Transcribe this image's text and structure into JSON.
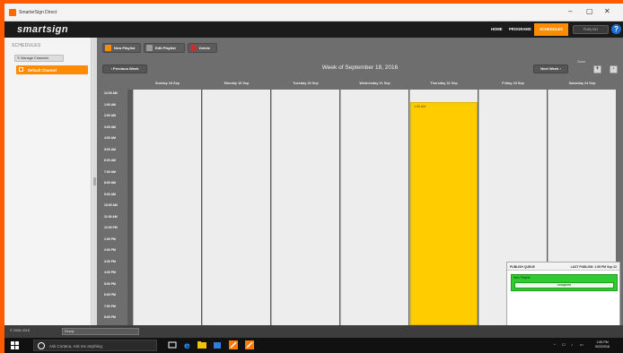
{
  "window": {
    "title": "SmarterSign Direct",
    "controls": {
      "minimize": "–",
      "maximize": "▢",
      "close": "✕"
    }
  },
  "header": {
    "logo_main": "smartsign",
    "nav": [
      "HOME",
      "PROGRAMS",
      "SCHEDULES"
    ],
    "active_nav": "SCHEDULES",
    "publish_label": "PUBLISH",
    "help_label": "?"
  },
  "sidebar": {
    "title": "SCHEDULES",
    "manage_label": "Manage Channels",
    "channels": [
      {
        "label": "Default Channel",
        "selected": true
      }
    ]
  },
  "toolbar": {
    "new_playlist": "New Playlist",
    "edit_playlist": "Edit Playlist",
    "delete": "Delete"
  },
  "calendar": {
    "prev_label": "Previous Week",
    "next_label": "Next Week",
    "week_title": "Week of September 18, 2016",
    "zoom_label": "Zoom",
    "zoom_in": "+",
    "zoom_out": "-",
    "days": [
      "Sunday 18 Sep",
      "Monday 19 Sep",
      "Tuesday 20 Sep",
      "Wednesday 21 Sep",
      "Thursday 22 Sep",
      "Friday 23 Sep",
      "Saturday 24 Sep"
    ],
    "times": [
      "12:00 AM",
      "1:00 AM",
      "2:00 AM",
      "3:00 AM",
      "4:00 AM",
      "5:00 AM",
      "6:00 AM",
      "7:00 AM",
      "8:00 AM",
      "9:00 AM",
      "10:00 AM",
      "11:00 AM",
      "12:00 PM",
      "1:00 PM",
      "2:00 PM",
      "3:00 PM",
      "4:00 PM",
      "5:00 PM",
      "6:00 PM",
      "7:00 PM",
      "8:00 PM"
    ],
    "event": {
      "day": "Thursday 22 Sep",
      "start_label": "1:00 AM",
      "color": "#ffcc00"
    }
  },
  "publish_queue": {
    "title": "PUBLISH QUEUE",
    "last_published": "LAST PUBLISH: 1:55 PM Sep 22",
    "item_name": "New Playlist",
    "status": "complete"
  },
  "status_bar": {
    "copyright": "© 2006-2016",
    "field": "Ready"
  },
  "taskbar": {
    "search_placeholder": "Ask Cortana, Ask me anything",
    "time": "1:55 PM",
    "date": "9/22/2016"
  },
  "colors": {
    "accent": "#ff8c00",
    "desktop": "#ff5a00",
    "event": "#ffcc00",
    "complete": "#2ecc2e"
  }
}
